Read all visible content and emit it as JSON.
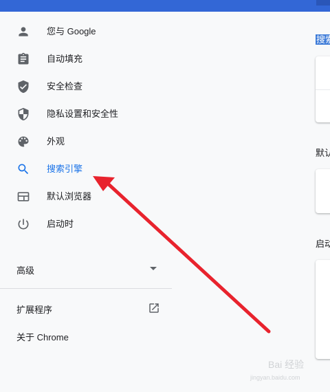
{
  "sidebar": {
    "items": [
      {
        "label": "您与 Google",
        "icon": "person-icon"
      },
      {
        "label": "自动填充",
        "icon": "clipboard-icon"
      },
      {
        "label": "安全检查",
        "icon": "shield-check-icon"
      },
      {
        "label": "隐私设置和安全性",
        "icon": "privacy-shield-icon"
      },
      {
        "label": "外观",
        "icon": "palette-icon"
      },
      {
        "label": "搜索引擎",
        "icon": "search-icon"
      },
      {
        "label": "默认浏览器",
        "icon": "browser-icon"
      },
      {
        "label": "启动时",
        "icon": "power-icon"
      }
    ],
    "active_index": 5,
    "advanced_label": "高级",
    "extensions_label": "扩展程序",
    "about_label": "关于 Chrome"
  },
  "main": {
    "search_engine_title": "搜索",
    "default_browser_title": "默认",
    "on_startup_title": "启动"
  },
  "watermark": {
    "text": "Bai 经验",
    "url": "jingyan.baidu.com"
  },
  "colors": {
    "topbar": "#3367d6",
    "active": "#1a73e8",
    "arrow": "#e8232d",
    "background": "#f8f9fa"
  }
}
